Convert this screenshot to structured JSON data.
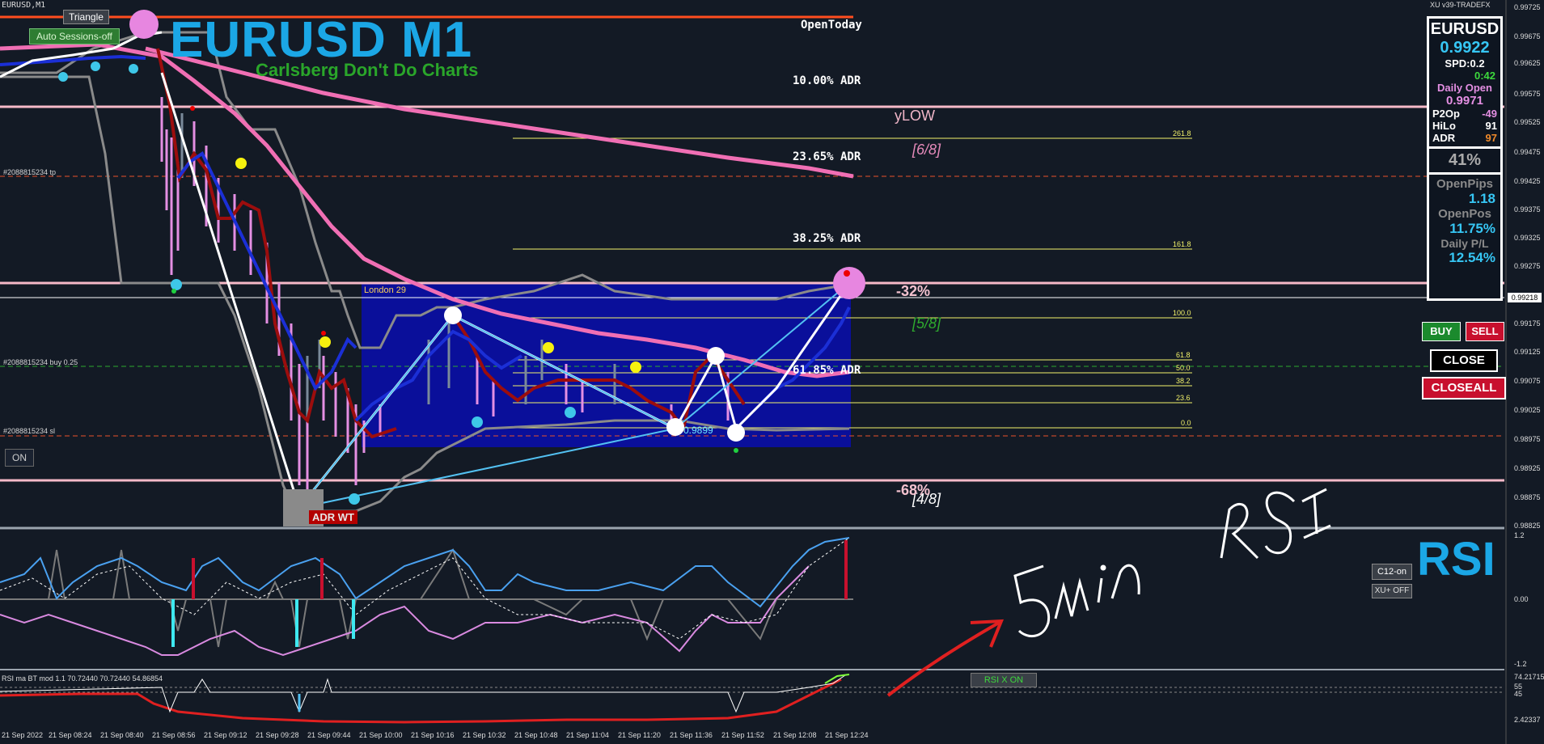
{
  "window": {
    "symbol": "EURUSD,M1",
    "broker": "XU v39-TRADEFX"
  },
  "buttons": {
    "triangle": "Triangle",
    "auto_sessions": "Auto Sessions-off",
    "on": "ON",
    "buy": "BUY",
    "sell": "SELL",
    "close": "CLOSE",
    "closeall": "CLOSEALL",
    "c12": "C12-on",
    "xu_off": "XU+ OFF",
    "rsi_x_on": "RSI X ON"
  },
  "title": {
    "main": "EURUSD M1",
    "sub": "Carlsberg Don't Do Charts"
  },
  "adr_levels": [
    "OpenToday",
    "10.00% ADR",
    "23.65% ADR",
    "38.25% ADR",
    "61.85% ADR"
  ],
  "fib_levels": [
    "261.8",
    "161.8",
    "100.0",
    "61.8",
    "50.0",
    "38.2",
    "23.6",
    "0.0"
  ],
  "murrey": {
    "ylow": "yLOW",
    "m6": "[6/8]",
    "m5": "[5/8]",
    "m4": "[4/8]",
    "pct_up": "-32%",
    "pct_down": "-68%"
  },
  "orders": {
    "tp": "#2088815234 tp",
    "buy": "#2088815234 buy 0.25",
    "sl": "#2088815234 sl"
  },
  "session": {
    "london": "London 29"
  },
  "marks": {
    "adr_wt": "ADR WT",
    "trend_low": "0.9899"
  },
  "panel": {
    "symbol": "EURUSD",
    "price": "0.9922",
    "spread": "SPD:0.2",
    "timer": "0:42",
    "daily_open_label": "Daily Open",
    "daily_open": "0.9971",
    "p2op_label": "P2Op",
    "p2op": "-49",
    "hilo_label": "HiLo",
    "hilo": "91",
    "adr_label": "ADR",
    "adr": "97",
    "adr_pct": "41%",
    "open_pips_label": "OpenPips",
    "open_pips": "1.18",
    "open_pos_label": "OpenPos",
    "open_pos": "11.75%",
    "daily_pl_label": "Daily P/L",
    "daily_pl": "12.54%"
  },
  "price_scale": [
    "0.99725",
    "0.99675",
    "0.99625",
    "0.99575",
    "0.99525",
    "0.99475",
    "0.99425",
    "0.99375",
    "0.99325",
    "0.99275",
    "0.99218",
    "0.99175",
    "0.99125",
    "0.99075",
    "0.99025",
    "0.98975",
    "0.98925",
    "0.98875",
    "0.98825"
  ],
  "current_price": "0.99218",
  "rsi_panel": {
    "title": "RSI",
    "scale": [
      "1.2",
      "0.00",
      "-1.2"
    ]
  },
  "rsi_sub": {
    "label": "RSI ma BT mod 1.1 70.72440 70.72440 54.86854",
    "scale": [
      "74.21715",
      "55",
      "45",
      "2.42337"
    ]
  },
  "x_axis": [
    "21 Sep 2022",
    "21 Sep 08:24",
    "21 Sep 08:40",
    "21 Sep 08:56",
    "21 Sep 09:12",
    "21 Sep 09:28",
    "21 Sep 09:44",
    "21 Sep 10:00",
    "21 Sep 10:16",
    "21 Sep 10:32",
    "21 Sep 10:48",
    "21 Sep 11:04",
    "21 Sep 11:20",
    "21 Sep 11:36",
    "21 Sep 11:52",
    "21 Sep 12:08",
    "21 Sep 12:24"
  ],
  "annotation": {
    "handwriting": "5min RSI"
  },
  "colors": {
    "bg": "#131a25",
    "accent_blue": "#1ba7e6",
    "box": "#0a0f9a",
    "buy": "#1b8a2d",
    "sell": "#c8102e",
    "ma_pink": "#f06fb4",
    "fib": "#f3f36a"
  }
}
